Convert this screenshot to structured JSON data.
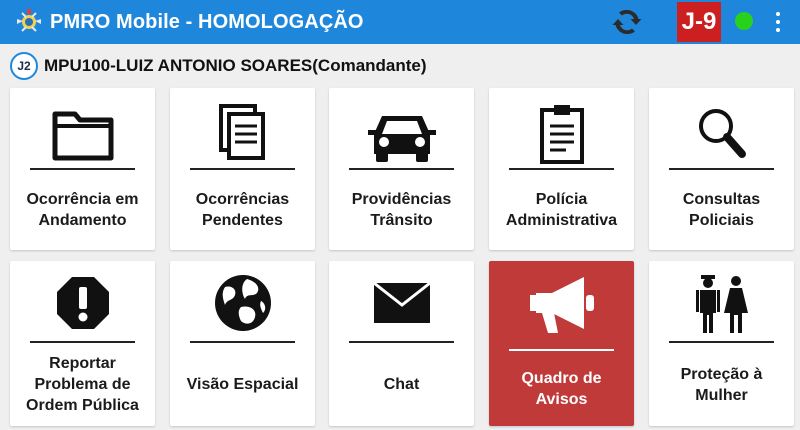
{
  "app": {
    "title": "PMRO Mobile - HOMOLOGAÇÃO",
    "unit_badge": "J-9"
  },
  "colors": {
    "app_bar": "#1e87dc",
    "badge": "#cc1f1f",
    "status_online": "#28d11c",
    "active_tile": "#c03a3a"
  },
  "user": {
    "chip": "J2",
    "name": "MPU100-LUIZ ANTONIO SOARES(Comandante)"
  },
  "tiles": [
    {
      "label": "Ocorrência em Andamento",
      "icon": "folder-icon"
    },
    {
      "label": "Ocorrências Pendentes",
      "icon": "documents-icon"
    },
    {
      "label": "Providências Trânsito",
      "icon": "car-icon"
    },
    {
      "label": "Polícia Administrativa",
      "icon": "clipboard-icon"
    },
    {
      "label": "Consultas Policiais",
      "icon": "search-icon"
    },
    {
      "label": "Reportar Problema de Ordem Pública",
      "icon": "alert-octagon-icon"
    },
    {
      "label": "Visão Espacial",
      "icon": "globe-icon"
    },
    {
      "label": "Chat",
      "icon": "envelope-icon"
    },
    {
      "label": "Quadro de Avisos",
      "icon": "megaphone-icon",
      "active": true
    },
    {
      "label": "Proteção à Mulher",
      "icon": "man-woman-icon"
    }
  ]
}
